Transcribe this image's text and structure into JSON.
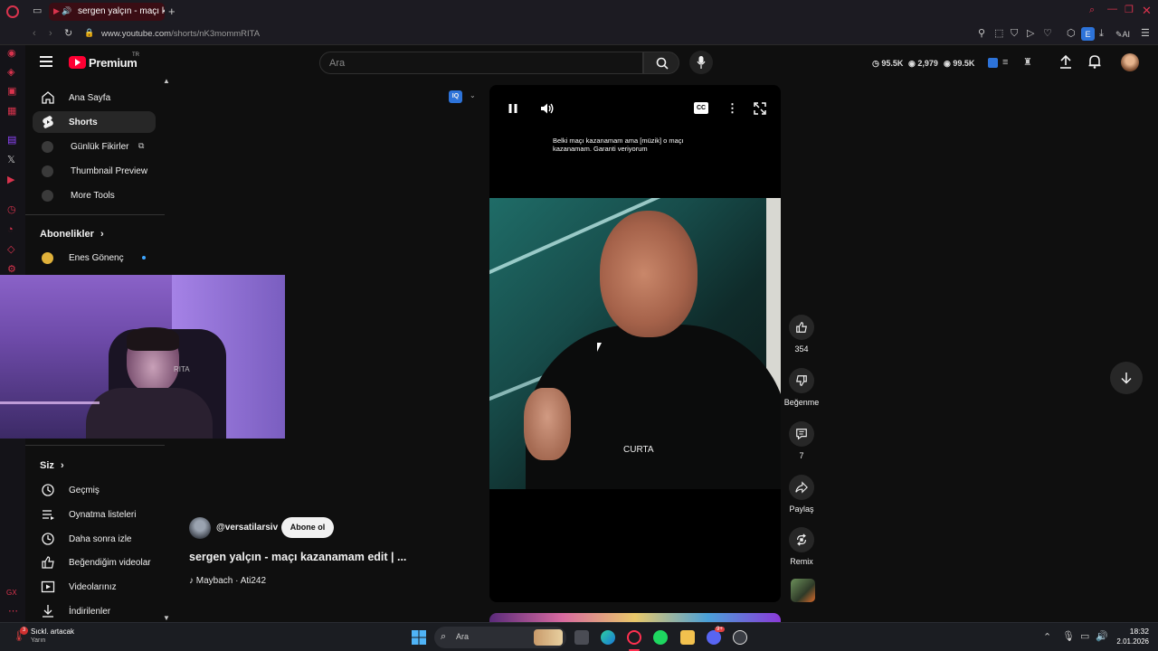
{
  "browser": {
    "tab_title": "sergen yalçın - maçı kazanamam edit",
    "address": "www.youtube.com/shorts/nK3mommRITA",
    "address_host": "www.youtube.com",
    "address_path": "/shorts/nK3mommRITA",
    "ai_label": "AI",
    "ext_badge": "E"
  },
  "youtube": {
    "logo_text": "Premium",
    "logo_region": "TR",
    "search_placeholder": "Ara",
    "stats": {
      "views_a": "95.5K",
      "count_b": "2,979",
      "views_c": "99.5K"
    },
    "sidebar": {
      "items": [
        {
          "label": "Ana Sayfa",
          "icon": "home-icon"
        },
        {
          "label": "Shorts",
          "icon": "shorts-icon",
          "active": true
        },
        {
          "label": "Günlük Fikirler",
          "icon": "ext-icon"
        },
        {
          "label": "Thumbnail Preview",
          "icon": "ext-icon"
        },
        {
          "label": "More Tools",
          "icon": "ext-icon"
        }
      ],
      "subscriptions_title": "Abonelikler",
      "subscriptions": [
        {
          "label": "Enes Gönenç"
        }
      ],
      "you_title": "Siz",
      "you_items": [
        {
          "label": "Geçmiş",
          "icon": "history-icon"
        },
        {
          "label": "Oynatma listeleri",
          "icon": "playlist-icon"
        },
        {
          "label": "Daha sonra izle",
          "icon": "clock-icon"
        },
        {
          "label": "Beğendiğim videolar",
          "icon": "thumbs-up-icon"
        },
        {
          "label": "Videolarınız",
          "icon": "video-icon"
        },
        {
          "label": "İndirilenler",
          "icon": "download-icon"
        }
      ]
    },
    "short": {
      "caption": "Belki maçı kazanamam ama [müzik] o maçı kazanamam. Garanti veriyorum",
      "on_screen_text": "CURTA",
      "channel": "@versatilarsiv",
      "subscribe_label": "Abone ol",
      "title": "sergen yalçın - maçı kazanamam edit | ...",
      "music": "Maybach · Ati242",
      "cc_label": "CC",
      "iq_label": "IQ"
    },
    "actions": {
      "like_count": "354",
      "dislike_label": "Beğenme",
      "comment_count": "7",
      "share_label": "Paylaş",
      "remix_label": "Remix"
    }
  },
  "webcam": {
    "overlay_text": "RITA"
  },
  "taskbar": {
    "notification_title": "Sıckl. artacak",
    "notification_sub": "Yarın",
    "search_label": "Ara",
    "time": "18:32",
    "date": "2.01.2026",
    "discord_badge": "9+"
  },
  "colors": {
    "yt_red": "#ff0033",
    "opera_red": "#d8334d",
    "subscribe_bg": "#f1f1f1"
  }
}
